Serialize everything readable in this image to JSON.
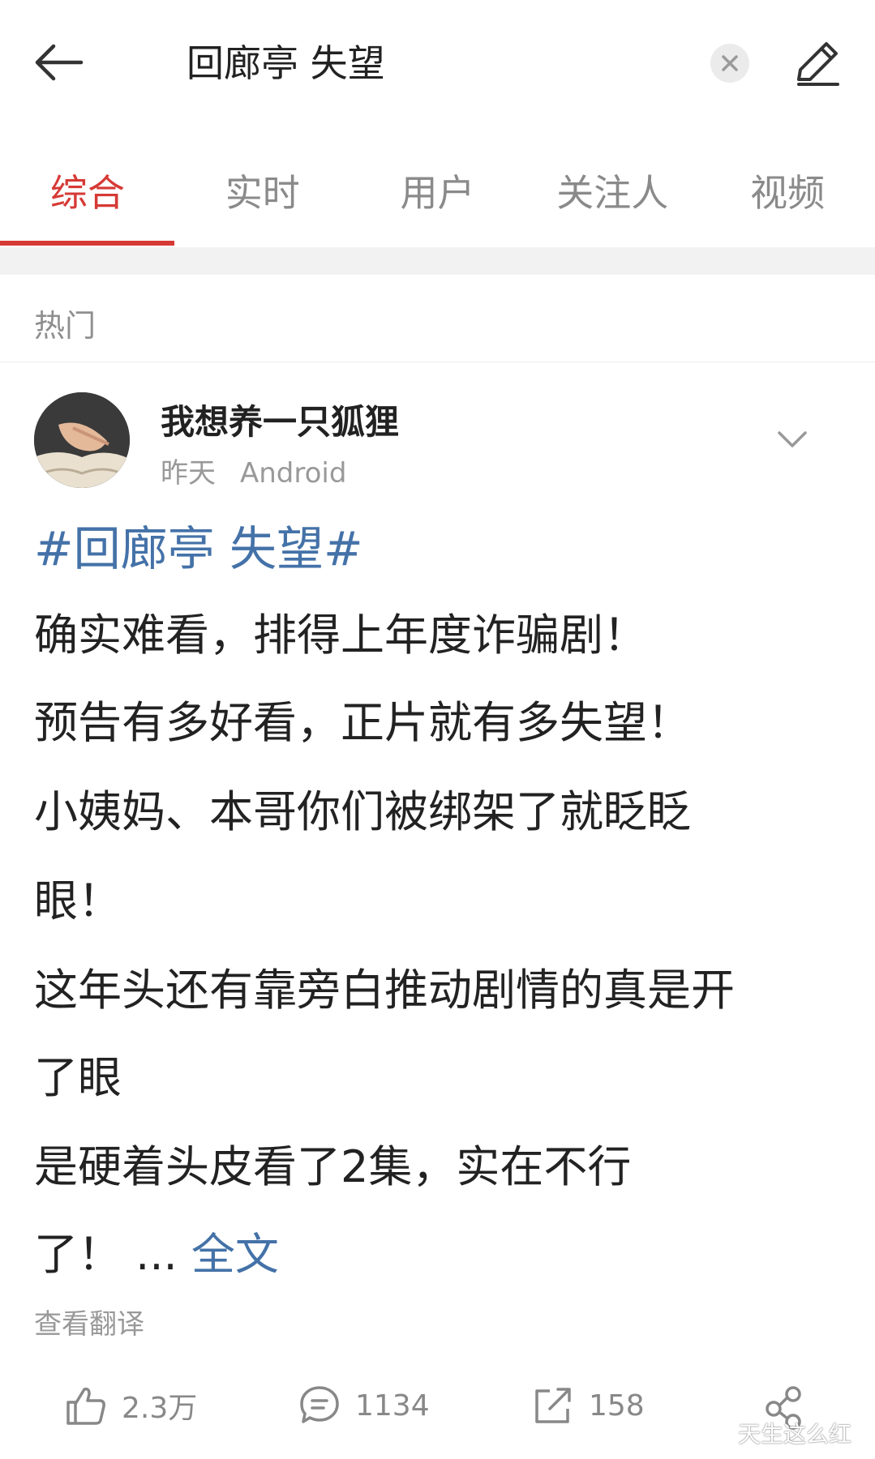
{
  "search": {
    "query": "回廊亭 失望"
  },
  "tabs": [
    {
      "label": "综合"
    },
    {
      "label": "实时"
    },
    {
      "label": "用户"
    },
    {
      "label": "关注人"
    },
    {
      "label": "视频"
    }
  ],
  "section": {
    "title": "热门"
  },
  "post": {
    "username": "我想养一只狐狸",
    "time": "昨天",
    "source": "Android",
    "hashtag": "#回廊亭 失望#",
    "lines": [
      "确实难看，排得上年度诈骗剧！",
      "预告有多好看，正片就有多失望！",
      "小姨妈、本哥你们被绑架了就眨眨",
      "眼！",
      "这年头还有靠旁白推动剧情的真是开",
      "了眼",
      "是硬着头皮看了2集，实在不行",
      "了！ ..."
    ],
    "full_text_link": "全文",
    "translate": "查看翻译"
  },
  "actions": {
    "likes": "2.3万",
    "comments": "1134",
    "reposts": "158"
  },
  "watermark": "天生这么红",
  "colors": {
    "accent": "#d63a36",
    "link": "#4472a8"
  }
}
